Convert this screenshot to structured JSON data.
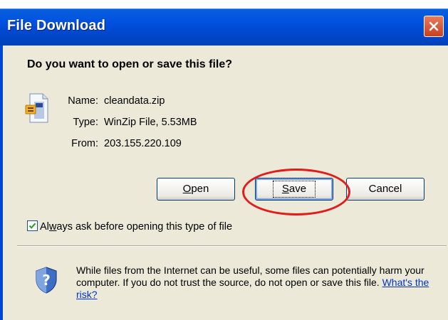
{
  "window": {
    "title": "File Download"
  },
  "dialog": {
    "question": "Do you want to open or save this file?",
    "file": {
      "name_label": "Name:",
      "name": "cleandata.zip",
      "type_label": "Type:",
      "type": "WinZip File, 5.53MB",
      "from_label": "From:",
      "from": "203.155.220.109"
    },
    "buttons": {
      "open": {
        "mnemonic": "O",
        "rest": "pen"
      },
      "save": {
        "mnemonic": "S",
        "rest": "ave"
      },
      "cancel": "Cancel"
    },
    "checkbox": {
      "checked": true,
      "pre": "Al",
      "mnemonic": "w",
      "post": "ays ask before opening this type of file"
    },
    "warning": {
      "text": "While files from the Internet can be useful, some files can potentially harm your computer. If you do not trust the source, do not open or save this file.",
      "link": "What's the risk?"
    }
  },
  "colors": {
    "titlebar": "#0053e0",
    "dialog_bg": "#ece9d8",
    "highlight": "#e21b1b",
    "link": "#0033cc"
  },
  "icons": [
    "close-icon",
    "zip-file-icon",
    "checkmark-icon",
    "security-shield-icon"
  ]
}
